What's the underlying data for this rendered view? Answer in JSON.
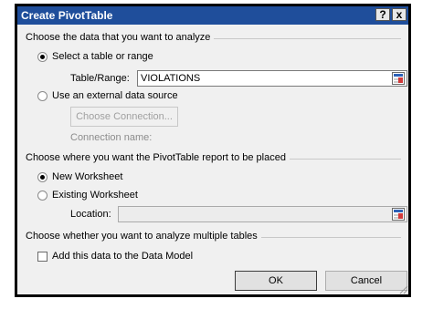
{
  "dialog": {
    "title": "Create PivotTable",
    "help_button": "?",
    "close_button": "x"
  },
  "section_data": {
    "heading": "Choose the data that you want to analyze",
    "select_table_label": "Select a table or range",
    "table_range_label": "Table/Range:",
    "table_range_value": "VIOLATIONS",
    "external_source_label": "Use an external data source",
    "choose_connection_button": "Choose Connection...",
    "connection_name_label": "Connection name:",
    "selected_option": "select_table"
  },
  "section_placement": {
    "heading": "Choose where you want the PivotTable report to be placed",
    "new_worksheet_label": "New Worksheet",
    "existing_worksheet_label": "Existing Worksheet",
    "location_label": "Location:",
    "location_value": "",
    "selected_option": "new_worksheet"
  },
  "section_multiple": {
    "heading": "Choose whether you want to analyze multiple tables",
    "data_model_label": "Add this data to the Data Model",
    "data_model_checked": false
  },
  "footer": {
    "ok_label": "OK",
    "cancel_label": "Cancel"
  },
  "colors": {
    "title_bar": "#1f4e9b",
    "dialog_bg": "#f0f0f0"
  },
  "icons": {
    "range_selector": "range-selector-icon",
    "resize_grip": "resize-grip-icon"
  }
}
